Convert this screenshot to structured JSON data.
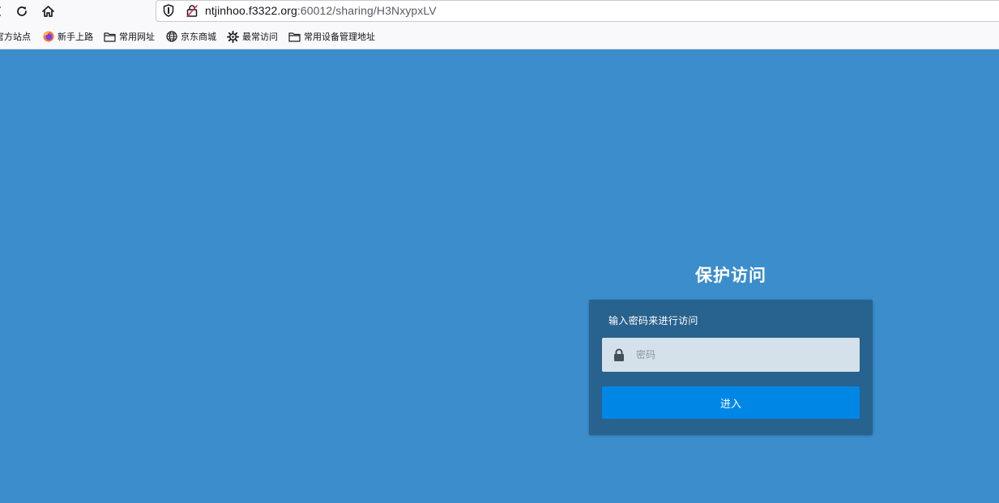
{
  "browser": {
    "url_host": "ntjinhoo.f3322.org",
    "url_rest": ":60012/sharing/H3NxypxLV"
  },
  "bookmarks": [
    {
      "label": "官方站点",
      "icon": "firefox-icon"
    },
    {
      "label": "新手上路",
      "icon": "firefox-icon"
    },
    {
      "label": "常用网址",
      "icon": "folder-icon"
    },
    {
      "label": "京东商城",
      "icon": "globe-icon"
    },
    {
      "label": "最常访问",
      "icon": "gear-icon"
    },
    {
      "label": "常用设备管理地址",
      "icon": "folder-icon"
    }
  ],
  "page": {
    "title": "保护访问",
    "prompt": "输入密码来进行访问",
    "password_placeholder": "密码",
    "enter_label": "进入"
  },
  "colors": {
    "page_background": "#3b8dcc",
    "card_background": "#28628e",
    "input_background": "#d4e1ea",
    "button_background": "#0087e6"
  }
}
